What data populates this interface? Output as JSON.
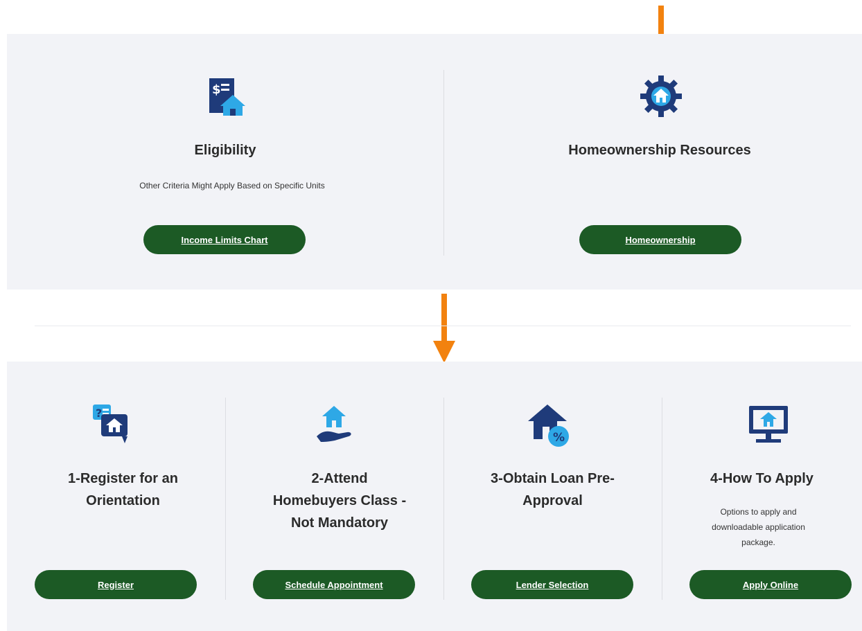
{
  "top": {
    "eligibility": {
      "title": "Eligibility",
      "description": "Other Criteria Might Apply Based on Specific Units",
      "button": "Income Limits Chart",
      "icon": "dollar-house-icon"
    },
    "resources": {
      "title": "Homeownership Resources",
      "button": "Homeownership",
      "icon": "gear-house-icon"
    }
  },
  "steps": [
    {
      "title": "1-Register for an Orientation",
      "button": "Register",
      "icon": "question-house-chat-icon"
    },
    {
      "title": "2-Attend Homebuyers Class - Not Mandatory",
      "button": "Schedule Appointment",
      "icon": "house-in-hand-icon"
    },
    {
      "title": "3-Obtain Loan Pre-Approval",
      "button": "Lender Selection",
      "icon": "house-percent-icon"
    },
    {
      "title": "4-How To Apply",
      "description": "Options to apply and downloadable application package.",
      "button": "Apply Online",
      "icon": "monitor-house-icon"
    }
  ],
  "colors": {
    "button": "#1c5a25",
    "panel": "#f2f3f7",
    "arrow": "#f2820f",
    "icon_dark": "#1f3b7a",
    "icon_light": "#2ea8e6"
  }
}
